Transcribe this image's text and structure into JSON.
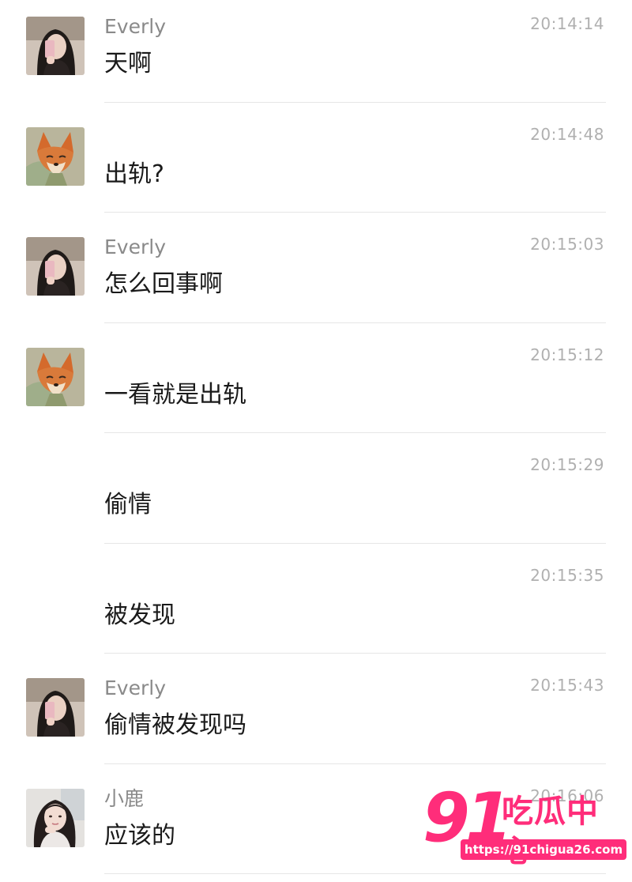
{
  "messages": [
    {
      "sender": "Everly",
      "time": "20:14:14",
      "text": "天啊",
      "avatar": "woman-selfie-avatar"
    },
    {
      "sender": "",
      "time": "20:14:48",
      "text": "出轨?",
      "avatar": "fox-cartoon-avatar"
    },
    {
      "sender": "Everly",
      "time": "20:15:03",
      "text": "怎么回事啊",
      "avatar": "woman-selfie-avatar"
    },
    {
      "sender": "",
      "time": "20:15:12",
      "text": "一看就是出轨",
      "avatar": "fox-cartoon-avatar"
    },
    {
      "sender": "",
      "time": "20:15:29",
      "text": "偷情",
      "avatar": ""
    },
    {
      "sender": "",
      "time": "20:15:35",
      "text": "被发现",
      "avatar": ""
    },
    {
      "sender": "Everly",
      "time": "20:15:43",
      "text": "偷情被发现吗",
      "avatar": "woman-selfie-avatar"
    },
    {
      "sender": "小鹿",
      "time": "20:16:06",
      "text": "应该的",
      "avatar": "girl-portrait-avatar"
    }
  ],
  "watermark": {
    "number": "91",
    "title": "吃瓜中心",
    "url": "https://91chigua26.com",
    "color": "#ff2d7a"
  },
  "colors": {
    "sender": "#8a8a8a",
    "time": "#b0b0b0",
    "text": "#1a1a1a",
    "divider": "#e6e6e6"
  }
}
